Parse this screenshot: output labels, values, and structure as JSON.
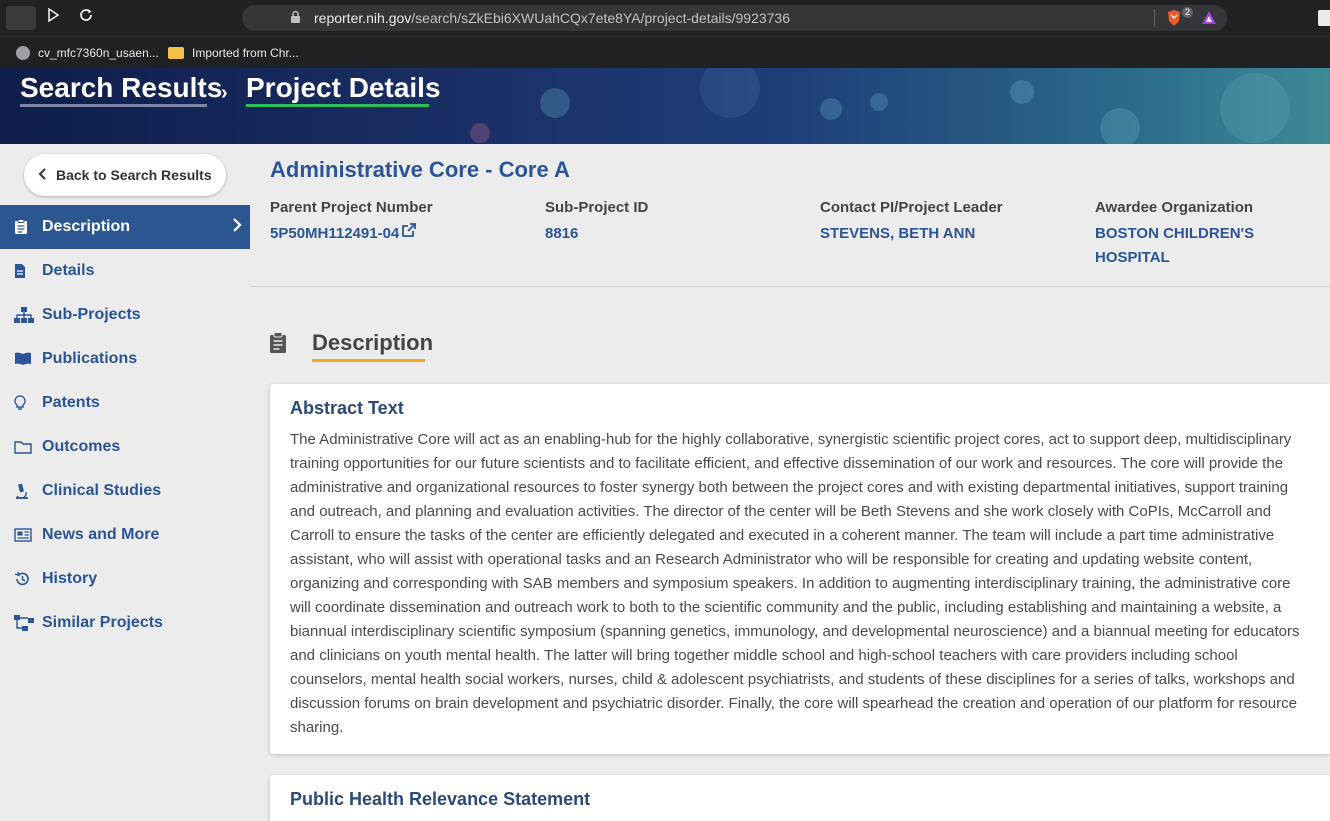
{
  "browser": {
    "url_host": "reporter.nih.gov",
    "url_path": "/search/sZkEbi6XWUahCQx7ete8YA/project-details/9923736",
    "shield_count": "2",
    "bookmarks": [
      {
        "label": "cv_mfc7360n_usaen..."
      },
      {
        "label": "Imported from Chr..."
      }
    ]
  },
  "breadcrumb": {
    "search_results": "Search Results",
    "separator": "›",
    "project_details": "Project Details"
  },
  "sidebar": {
    "back_label": "Back to Search Results",
    "items": [
      {
        "label": "Description",
        "icon": "clipboard-icon",
        "active": true
      },
      {
        "label": "Details",
        "icon": "document-icon"
      },
      {
        "label": "Sub-Projects",
        "icon": "hierarchy-icon"
      },
      {
        "label": "Publications",
        "icon": "book-icon"
      },
      {
        "label": "Patents",
        "icon": "lightbulb-icon"
      },
      {
        "label": "Outcomes",
        "icon": "folder-icon"
      },
      {
        "label": "Clinical Studies",
        "icon": "microscope-icon"
      },
      {
        "label": "News and More",
        "icon": "newspaper-icon"
      },
      {
        "label": "History",
        "icon": "history-icon"
      },
      {
        "label": "Similar Projects",
        "icon": "network-icon"
      }
    ]
  },
  "project": {
    "title": "Administrative Core - Core A",
    "parent_label": "Parent Project Number",
    "parent_value": "5P50MH112491-04",
    "subproject_label": "Sub-Project ID",
    "subproject_value": "8816",
    "pi_label": "Contact PI/Project Leader",
    "pi_value": "STEVENS, BETH ANN",
    "org_label": "Awardee Organization",
    "org_value": "BOSTON CHILDREN'S HOSPITAL"
  },
  "description": {
    "section_title": "Description",
    "abstract_title": "Abstract Text",
    "abstract_text": "The Administrative Core will act as an enabling-hub for the highly collaborative, synergistic scientific project cores, act to support deep, multidisciplinary training opportunities for our future scientists and to facilitate efficient, and effective dissemination of our work and resources. The core will provide the administrative and organizational resources to foster synergy both between the project cores and with existing departmental initiatives, support training and outreach, and planning and evaluation activities. The director of the center will be Beth Stevens and she work closely with CoPIs, McCarroll and Carroll to ensure the tasks of the center are efficiently delegated and executed in a coherent manner. The team will include a part time administrative assistant, who will assist with operational tasks and an Research Administrator who will be responsible for creating and updating website content, organizing and corresponding with SAB members and symposium speakers. In addition to augmenting interdisciplinary training, the administrative core will coordinate dissemination and outreach work to both to the scientific community and the public, including establishing and maintaining a website, a biannual interdisciplinary scientific symposium (spanning genetics, immunology, and developmental neuroscience) and a biannual meeting for educators and clinicians on youth mental health. The latter will bring together middle school and high-school teachers with care providers including school counselors, mental health social workers, nurses, child & adolescent psychiatrists, and students of these disciplines for a series of talks, workshops and discussion forums on brain development and psychiatric disorder. Finally, the core will spearhead the creation and operation of our platform for resource sharing.",
    "phr_title": "Public Health Relevance Statement"
  },
  "colors": {
    "primary": "#2b5597",
    "active_nav": "#2c5692",
    "breadcrumb_active_underline": "#2fbf5a",
    "section_underline": "#f0a81e"
  }
}
